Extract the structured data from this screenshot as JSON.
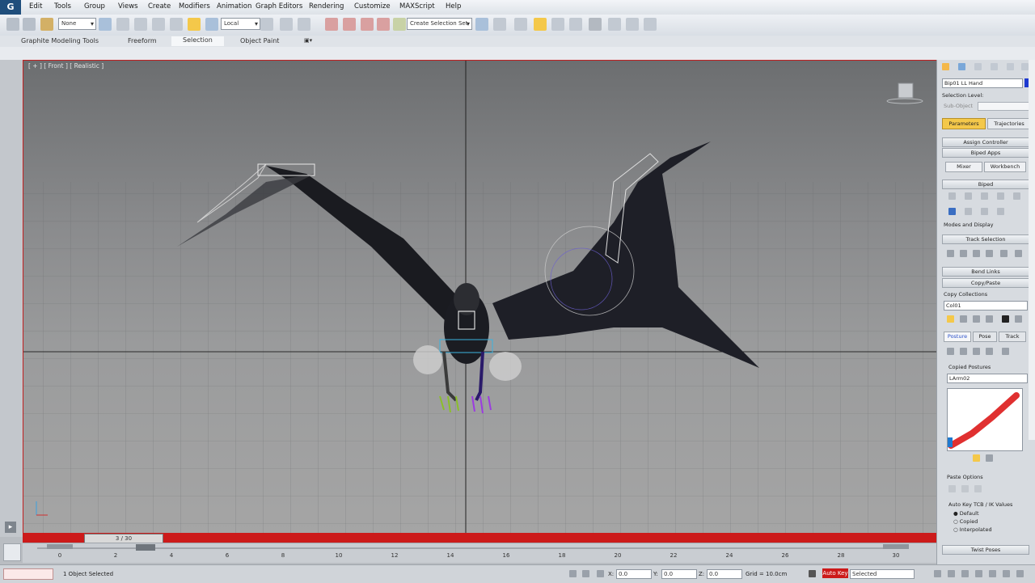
{
  "menubar": {
    "logo": "G",
    "items": [
      "Edit",
      "Tools",
      "Group",
      "Views",
      "Create",
      "Modifiers",
      "Animation",
      "Graph Editors",
      "Rendering",
      "Customize",
      "MAXScript",
      "Help"
    ]
  },
  "toolbar": {
    "selection_filter": "None",
    "ref_coord": "Local",
    "named_selection": "Create Selection Set"
  },
  "ribbon": {
    "tabs": [
      "Graphite Modeling Tools",
      "Freeform",
      "Selection",
      "Object Paint"
    ],
    "active_tab": "Selection"
  },
  "viewport": {
    "label": "[ + ] [ Front ] [ Realistic ]"
  },
  "command_panel": {
    "object_name": "Bip01 LL Hand",
    "selection_level": "Selection Level:",
    "sub_object": "Sub-Object",
    "tab_parameters": "Parameters",
    "tab_trajectories": "Trajectories",
    "assign_controller": "Assign Controller",
    "biped_apps": "Biped Apps",
    "mixer": "Mixer",
    "workbench": "Workbench",
    "biped": "Biped",
    "modes_display": "Modes and Display",
    "track_selection": "Track Selection",
    "bend_links": "Bend Links",
    "copy_paste": "Copy/Paste",
    "copy_collections": "Copy Collections",
    "collection_value": "Col01",
    "pose": "Posture",
    "pose_tab": "Pose",
    "track_tab": "Track",
    "copied_postures": "Copied Postures",
    "posture_value": "LArm02",
    "paste_options": "Paste Options",
    "auto_key_label": "Auto Key TCB / IK Values",
    "opt_default": "Default",
    "opt_copied": "Copied",
    "opt_interpolated": "Interpolated",
    "twist_poses": "Twist Poses"
  },
  "timeline": {
    "frame_display": "3 / 30",
    "ticks": [
      "0",
      "2",
      "4",
      "6",
      "8",
      "10",
      "12",
      "14",
      "16",
      "18",
      "20",
      "22",
      "24",
      "26",
      "28",
      "30"
    ]
  },
  "status": {
    "objects_selected": "1 Object Selected",
    "x_value": "0.0",
    "y_value": "0.0",
    "z_value": "0.0",
    "grid": "Grid = 10.0cm",
    "auto_key": "Auto Key",
    "set_key_filter": "Selected"
  },
  "colors": {
    "accent_red": "#cc1a1a",
    "active_tab_yellow": "#f4c84a",
    "swatch_blue": "#1f3ad0"
  }
}
